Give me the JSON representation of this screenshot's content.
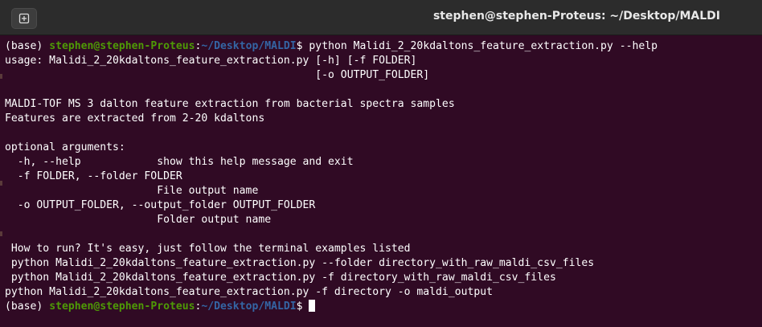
{
  "window": {
    "title": "stephen@stephen-Proteus: ~/Desktop/MALDI",
    "new_tab_icon": "new-tab-icon"
  },
  "terminal": {
    "colors": {
      "background": "#300a24",
      "text": "#ffffff",
      "user_host": "#4e9a06",
      "path": "#3465a4"
    },
    "prompt": {
      "env": "(base) ",
      "user_host": "stephen@stephen-Proteus",
      "colon": ":",
      "path": "~/Desktop/MALDI",
      "dollar": "$ "
    },
    "command": "python Malidi_2_20kdaltons_feature_extraction.py --help",
    "output": [
      "usage: Malidi_2_20kdaltons_feature_extraction.py [-h] [-f FOLDER]",
      "                                                 [-o OUTPUT_FOLDER]",
      "",
      "MALDI-TOF MS 3 dalton feature extraction from bacterial spectra samples",
      "Features are extracted from 2-20 kdaltons",
      "",
      "optional arguments:",
      "  -h, --help            show this help message and exit",
      "  -f FOLDER, --folder FOLDER",
      "                        File output name",
      "  -o OUTPUT_FOLDER, --output_folder OUTPUT_FOLDER",
      "                        Folder output name",
      "",
      " How to run? It's easy, just follow the terminal examples listed",
      " python Malidi_2_20kdaltons_feature_extraction.py --folder directory_with_raw_maldi_csv_files",
      " python Malidi_2_20kdaltons_feature_extraction.py -f directory_with_raw_maldi_csv_files",
      "python Malidi_2_20kdaltons_feature_extraction.py -f directory -o maldi_output"
    ]
  }
}
